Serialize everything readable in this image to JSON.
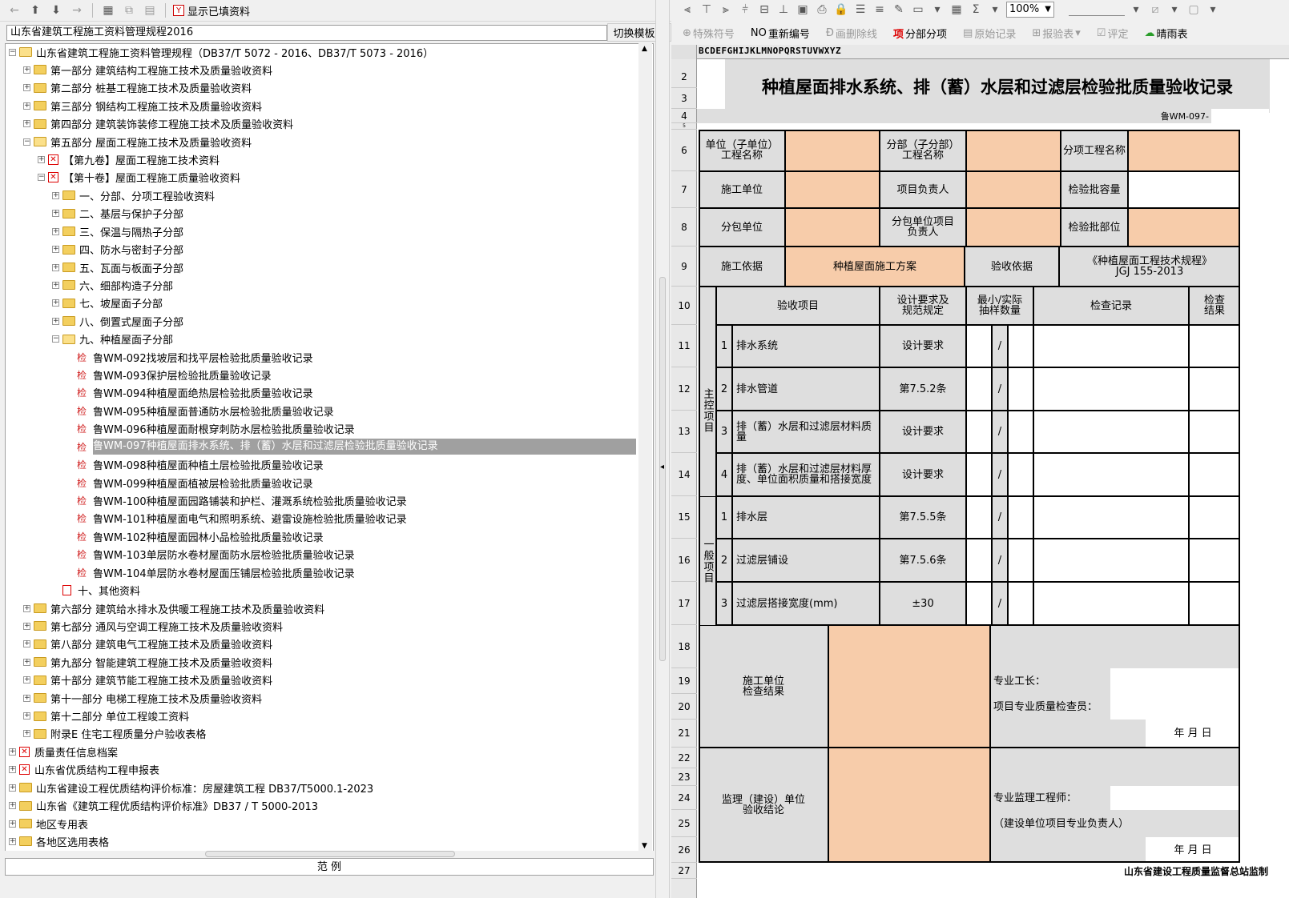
{
  "left_toolbar": {
    "show_filled_label": "显示已填资料"
  },
  "left_select": {
    "value": "山东省建筑工程施工资料管理规程2016",
    "switch_label": "切换模板库"
  },
  "tree": [
    {
      "level": 0,
      "exp": "-",
      "icon": "folder-open",
      "label": "山东省建筑工程施工资料管理规程（DB37/T 5072 - 2016、DB37/T 5073 - 2016）"
    },
    {
      "level": 1,
      "exp": "+",
      "icon": "folder",
      "label": "第一部分  建筑结构工程施工技术及质量验收资料"
    },
    {
      "level": 1,
      "exp": "+",
      "icon": "folder",
      "label": "第二部分  桩基工程施工技术及质量验收资料"
    },
    {
      "level": 1,
      "exp": "+",
      "icon": "folder",
      "label": "第三部分  钢结构工程施工技术及质量验收资料"
    },
    {
      "level": 1,
      "exp": "+",
      "icon": "folder",
      "label": "第四部分  建筑装饰装修工程施工技术及质量验收资料"
    },
    {
      "level": 1,
      "exp": "-",
      "icon": "folder-open",
      "label": "第五部分  屋面工程施工技术及质量验收资料"
    },
    {
      "level": 2,
      "exp": "+",
      "icon": "xbox",
      "label": "【第九卷】屋面工程施工技术资料"
    },
    {
      "level": 2,
      "exp": "-",
      "icon": "xbox",
      "label": "【第十卷】屋面工程施工质量验收资料"
    },
    {
      "level": 3,
      "exp": "+",
      "icon": "folder",
      "label": "一、分部、分项工程验收资料"
    },
    {
      "level": 3,
      "exp": "+",
      "icon": "folder",
      "label": "二、基层与保护子分部"
    },
    {
      "level": 3,
      "exp": "+",
      "icon": "folder",
      "label": "三、保温与隔热子分部"
    },
    {
      "level": 3,
      "exp": "+",
      "icon": "folder",
      "label": "四、防水与密封子分部"
    },
    {
      "level": 3,
      "exp": "+",
      "icon": "folder",
      "label": "五、瓦面与板面子分部"
    },
    {
      "level": 3,
      "exp": "+",
      "icon": "folder",
      "label": "六、细部构造子分部"
    },
    {
      "level": 3,
      "exp": "+",
      "icon": "folder",
      "label": "七、坡屋面子分部"
    },
    {
      "level": 3,
      "exp": "+",
      "icon": "folder",
      "label": "八、倒置式屋面子分部"
    },
    {
      "level": 3,
      "exp": "-",
      "icon": "folder-open",
      "label": "九、种植屋面子分部"
    },
    {
      "level": 4,
      "exp": "",
      "icon": "jian",
      "label": "鲁WM-092找坡层和找平层检验批质量验收记录"
    },
    {
      "level": 4,
      "exp": "",
      "icon": "jian",
      "label": "鲁WM-093保护层检验批质量验收记录"
    },
    {
      "level": 4,
      "exp": "",
      "icon": "jian",
      "label": "鲁WM-094种植屋面绝热层检验批质量验收记录"
    },
    {
      "level": 4,
      "exp": "",
      "icon": "jian",
      "label": "鲁WM-095种植屋面普通防水层检验批质量验收记录"
    },
    {
      "level": 4,
      "exp": "",
      "icon": "jian",
      "label": "鲁WM-096种植屋面耐根穿刺防水层检验批质量验收记录"
    },
    {
      "level": 4,
      "exp": "",
      "icon": "jian",
      "label": "鲁WM-097种植屋面排水系统、排（蓄）水层和过滤层检验批质量验收记录",
      "selected": true
    },
    {
      "level": 4,
      "exp": "",
      "icon": "jian",
      "label": "鲁WM-098种植屋面种植土层检验批质量验收记录"
    },
    {
      "level": 4,
      "exp": "",
      "icon": "jian",
      "label": "鲁WM-099种植屋面植被层检验批质量验收记录"
    },
    {
      "level": 4,
      "exp": "",
      "icon": "jian",
      "label": "鲁WM-100种植屋面园路铺装和护栏、灌溉系统检验批质量验收记录"
    },
    {
      "level": 4,
      "exp": "",
      "icon": "jian",
      "label": "鲁WM-101种植屋面电气和照明系统、避雷设施检验批质量验收记录"
    },
    {
      "level": 4,
      "exp": "",
      "icon": "jian",
      "label": "鲁WM-102种植屋面园林小品检验批质量验收记录"
    },
    {
      "level": 4,
      "exp": "",
      "icon": "jian",
      "label": "鲁WM-103单层防水卷材屋面防水层检验批质量验收记录"
    },
    {
      "level": 4,
      "exp": "",
      "icon": "jian",
      "label": "鲁WM-104单层防水卷材屋面压铺层检验批质量验收记录"
    },
    {
      "level": 3,
      "exp": "",
      "icon": "doc",
      "label": "十、其他资料"
    },
    {
      "level": 1,
      "exp": "+",
      "icon": "folder",
      "label": "第六部分  建筑给水排水及供暖工程施工技术及质量验收资料"
    },
    {
      "level": 1,
      "exp": "+",
      "icon": "folder",
      "label": "第七部分  通风与空调工程施工技术及质量验收资料"
    },
    {
      "level": 1,
      "exp": "+",
      "icon": "folder",
      "label": "第八部分  建筑电气工程施工技术及质量验收资料"
    },
    {
      "level": 1,
      "exp": "+",
      "icon": "folder",
      "label": "第九部分  智能建筑工程施工技术及质量验收资料"
    },
    {
      "level": 1,
      "exp": "+",
      "icon": "folder",
      "label": "第十部分  建筑节能工程施工技术及质量验收资料"
    },
    {
      "level": 1,
      "exp": "+",
      "icon": "folder",
      "label": "第十一部分  电梯工程施工技术及质量验收资料"
    },
    {
      "level": 1,
      "exp": "+",
      "icon": "folder",
      "label": "第十二部分  单位工程竣工资料"
    },
    {
      "level": 1,
      "exp": "+",
      "icon": "folder",
      "label": "附录E  住宅工程质量分户验收表格"
    },
    {
      "level": 0,
      "exp": "+",
      "icon": "xbox",
      "label": "质量责任信息档案"
    },
    {
      "level": 0,
      "exp": "+",
      "icon": "xbox",
      "label": "山东省优质结构工程申报表"
    },
    {
      "level": 0,
      "exp": "+",
      "icon": "folder",
      "label": "山东省建设工程优质结构评价标准：房屋建筑工程 DB37/T5000.1-2023"
    },
    {
      "level": 0,
      "exp": "+",
      "icon": "folder",
      "label": "山东省《建筑工程优质结构评价标准》DB37 / T 5000-2013"
    },
    {
      "level": 0,
      "exp": "+",
      "icon": "folder",
      "label": "地区专用表"
    },
    {
      "level": 0,
      "exp": "+",
      "icon": "folder",
      "label": "各地区选用表格"
    }
  ],
  "legend_label": "范      例",
  "right_toolbar": {
    "zoom": "100%",
    "items": [
      "特殊符号",
      "重新编号",
      "画删除线",
      "分部分项",
      "原始记录",
      "报验表",
      "评定",
      "晴雨表"
    ],
    "no_prefix": "NO",
    "xiang_prefix": "项"
  },
  "col_letters": "BCDEFGHIJKLMNOPQRSTUVWXYZ",
  "row_numbers": [
    "2",
    "3",
    "4",
    "5",
    "6",
    "7",
    "8",
    "9",
    "10",
    "11",
    "12",
    "13",
    "14",
    "15",
    "16",
    "17",
    "18",
    "19",
    "20",
    "21",
    "22",
    "23",
    "24",
    "25",
    "26",
    "27"
  ],
  "form": {
    "title": "种植屋面排水系统、排（蓄）水层和过滤层检验批质量验收记录",
    "code": "鲁WM-097-",
    "unit_name": "单位（子单位）\n工程名称",
    "sub_name": "分部（子分部）\n工程名称",
    "item_name": "分项工程名称",
    "constructor": "施工单位",
    "pm": "项目负责人",
    "capacity": "检验批容量",
    "subcontractor": "分包单位",
    "sub_pm": "分包单位项目\n负责人",
    "part": "检验批部位",
    "basis": "施工依据",
    "basis_val": "种植屋面施工方案",
    "accept_basis": "验收依据",
    "accept_basis_val": "《种植屋面工程技术规程》\nJGJ 155-2013",
    "h_item": "验收项目",
    "h_design": "设计要求及\n规范规定",
    "h_sample": "最小/实际\n抽样数量",
    "h_record": "检查记录",
    "h_result": "检查\n结果",
    "main_label": "主控项目",
    "general_label": "一般项目",
    "main_items": [
      {
        "no": "1",
        "name": "排水系统",
        "req": "设计要求"
      },
      {
        "no": "2",
        "name": "排水管道",
        "req": "第7.5.2条"
      },
      {
        "no": "3",
        "name": "排（蓄）水层和过滤层材料质量",
        "req": "设计要求"
      },
      {
        "no": "4",
        "name": "排（蓄）水层和过滤层材料厚度、单位面积质量和搭接宽度",
        "req": "设计要求"
      }
    ],
    "general_items": [
      {
        "no": "1",
        "name": "排水层",
        "req": "第7.5.5条"
      },
      {
        "no": "2",
        "name": "过滤层铺设",
        "req": "第7.5.6条"
      },
      {
        "no": "3",
        "name": "过滤层搭接宽度(mm)",
        "req": "±30"
      }
    ],
    "slash": "/",
    "con_result": "施工单位\n检查结果",
    "foreman": "专业工长：",
    "inspector": "项目专业质量检查员：",
    "date": "年   月   日",
    "sup_result": "监理（建设）单位\n验收结论",
    "sup_engineer": "专业监理工程师：",
    "owner_rep": "（建设单位项目专业负责人）",
    "footer": "山东省建设工程质量监督总站监制"
  }
}
